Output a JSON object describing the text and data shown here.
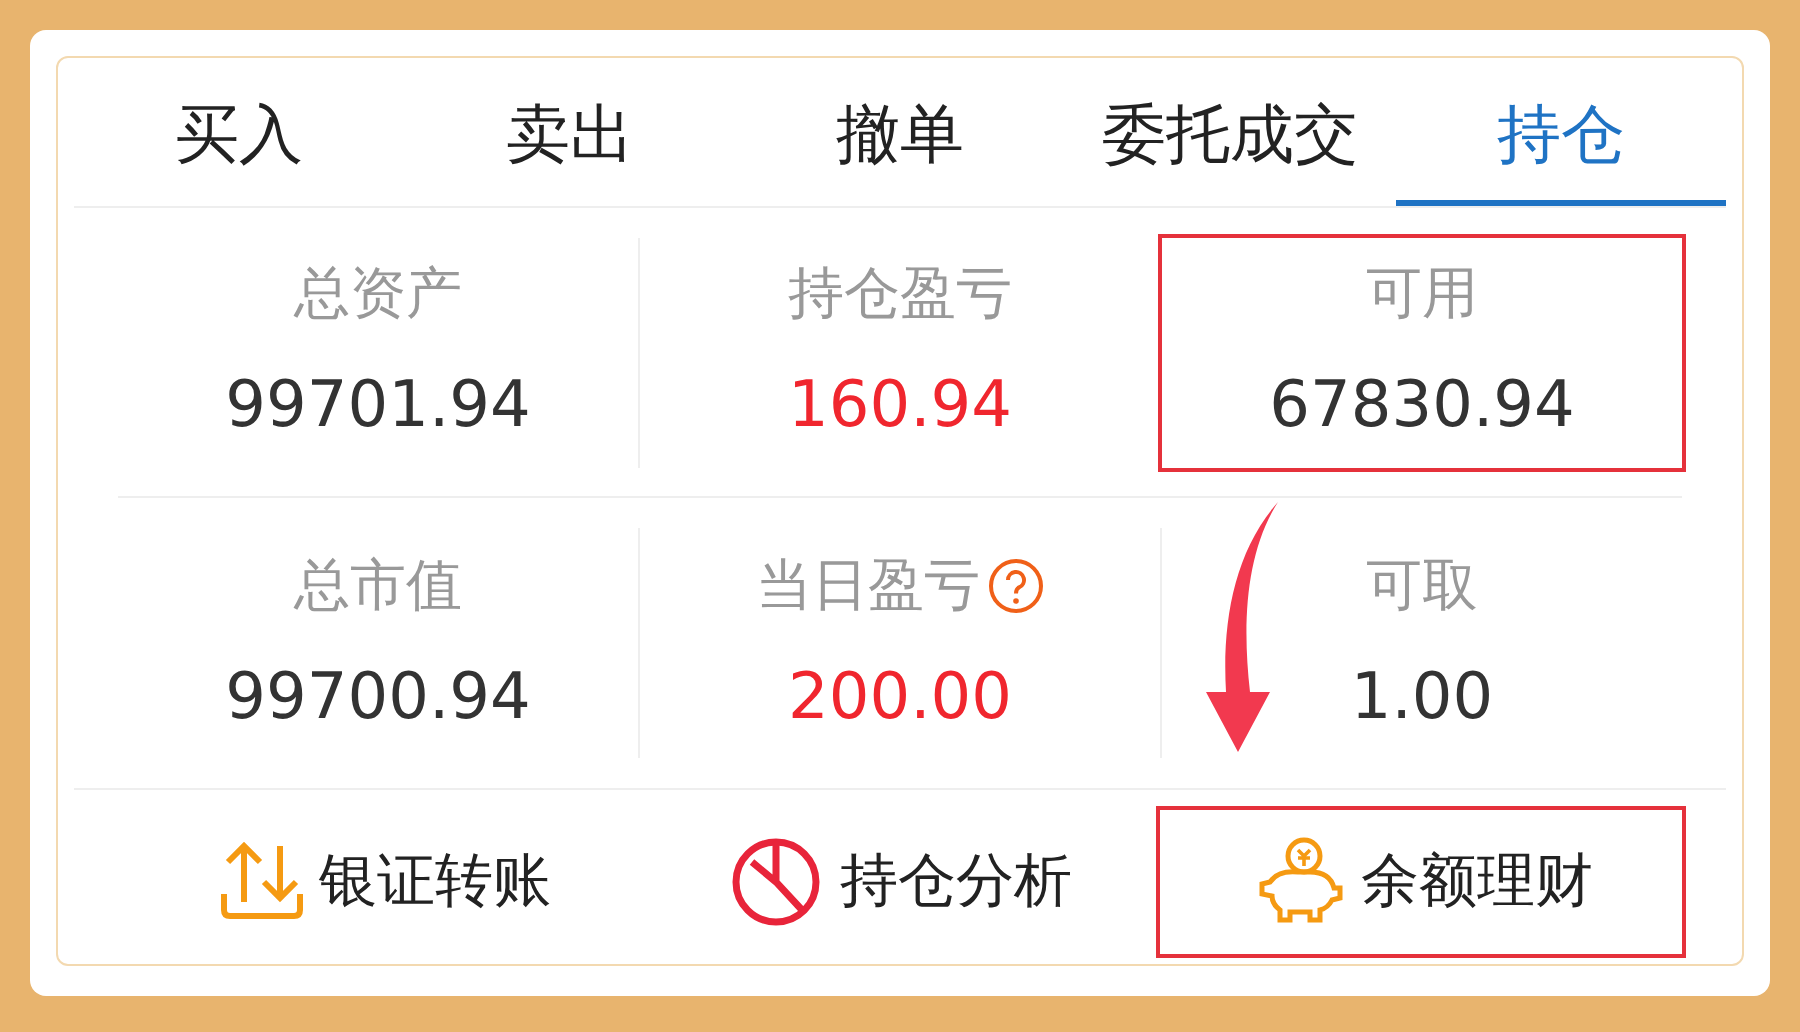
{
  "tabs": [
    {
      "label": "买入",
      "selected": false
    },
    {
      "label": "卖出",
      "selected": false
    },
    {
      "label": "撤单",
      "selected": false
    },
    {
      "label": "委托成交",
      "selected": false
    },
    {
      "label": "持仓",
      "selected": true
    }
  ],
  "summary": [
    [
      {
        "label": "总资产",
        "value": "99701.94",
        "color": "#333333",
        "highlighted": false,
        "help": false
      },
      {
        "label": "持仓盈亏",
        "value": "160.94",
        "color": "#f0262e",
        "highlighted": false,
        "help": false
      },
      {
        "label": "可用",
        "value": "67830.94",
        "color": "#333333",
        "highlighted": true,
        "help": false
      }
    ],
    [
      {
        "label": "总市值",
        "value": "99700.94",
        "color": "#333333",
        "highlighted": false,
        "help": false
      },
      {
        "label": "当日盈亏",
        "value": "200.00",
        "color": "#f0262e",
        "highlighted": false,
        "help": true
      },
      {
        "label": "可取",
        "value": "1.00",
        "color": "#333333",
        "highlighted": false,
        "help": false
      }
    ]
  ],
  "actions": [
    {
      "label": "银证转账",
      "kind": "transfer",
      "highlighted": false
    },
    {
      "label": "持仓分析",
      "kind": "analysis",
      "highlighted": false
    },
    {
      "label": "余额理财",
      "kind": "savings",
      "highlighted": true
    }
  ]
}
